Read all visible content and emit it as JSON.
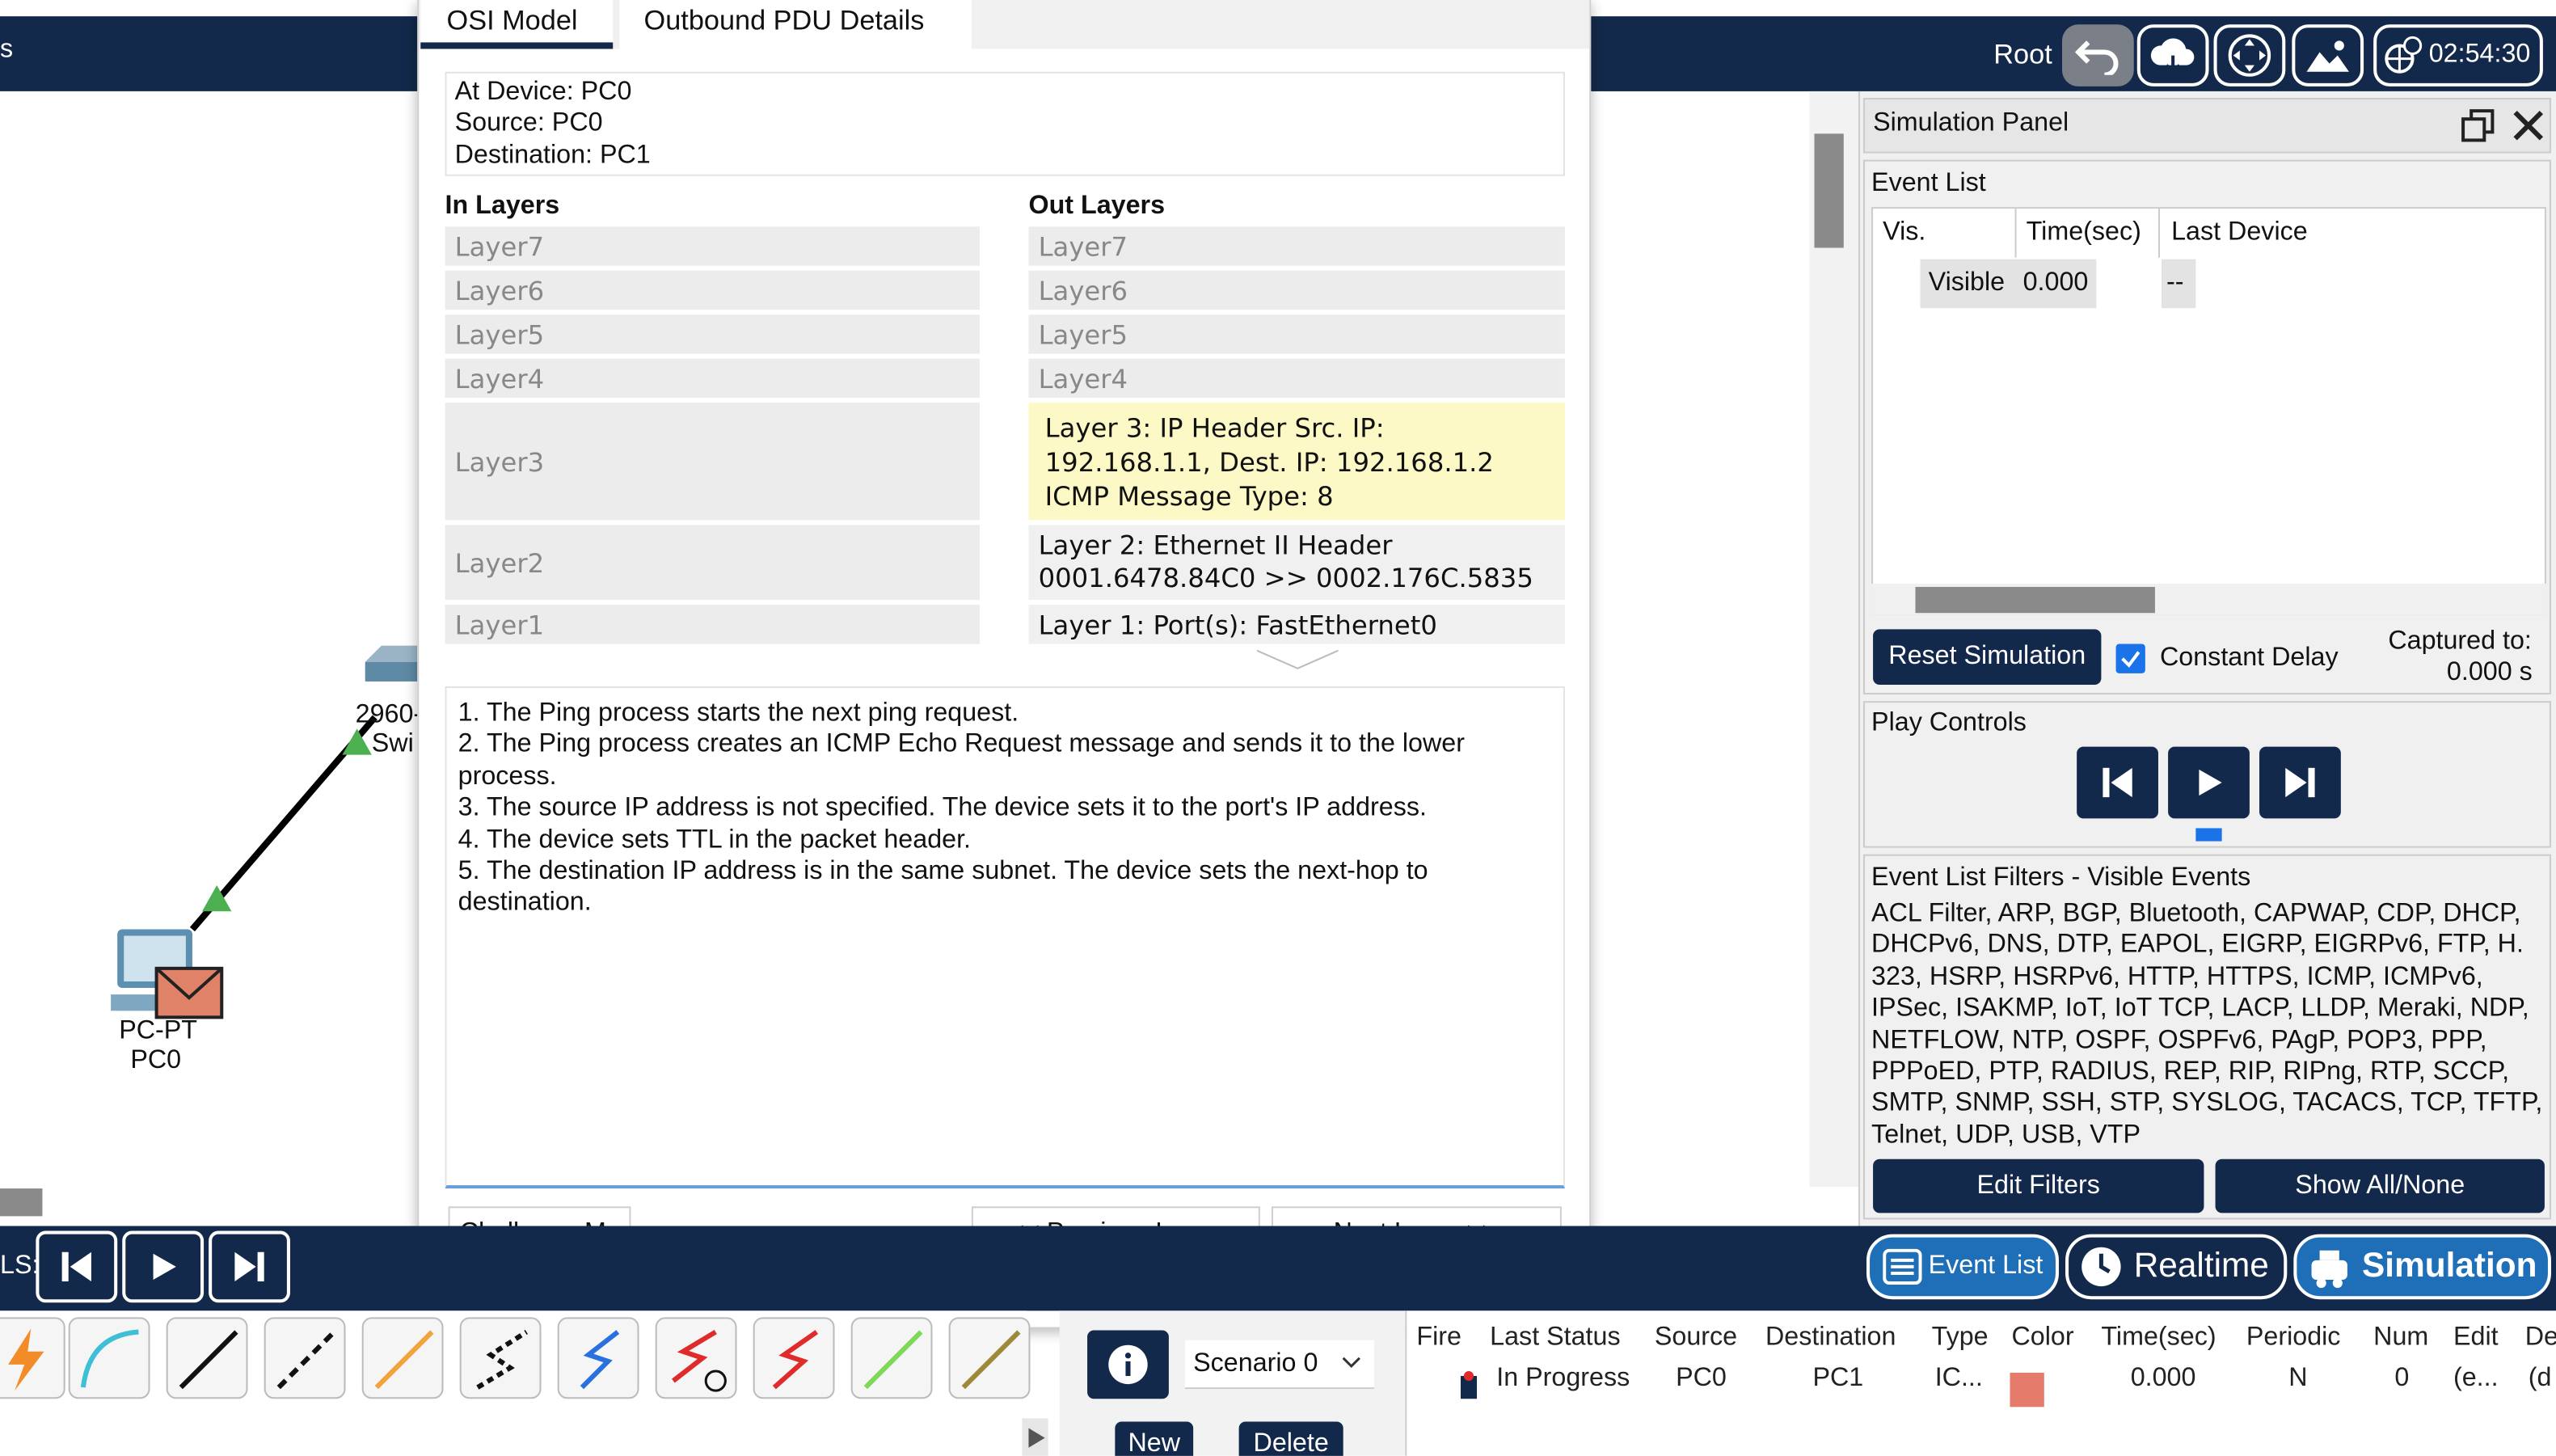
{
  "top_bar": {
    "root_label": "Root",
    "clock": "02:54:30",
    "left_fragment": "s"
  },
  "dialog": {
    "tabs": [
      "OSI Model",
      "Outbound PDU Details"
    ],
    "at_device": "At Device: PC0",
    "source": "Source: PC0",
    "destination": "Destination: PC1",
    "in_layers_title": "In Layers",
    "out_layers_title": "Out Layers",
    "in_layers": [
      "Layer7",
      "Layer6",
      "Layer5",
      "Layer4",
      "Layer3",
      "Layer2",
      "Layer1"
    ],
    "out_layers": [
      "Layer7",
      "Layer6",
      "Layer5",
      "Layer4"
    ],
    "out_layer3": "Layer 3: IP Header Src. IP: 192.168.1.1, Dest. IP: 192.168.1.2 ICMP Message Type: 8",
    "out_layer2_line1": "Layer 2: Ethernet II Header",
    "out_layer2_line2": "0001.6478.84C0 >> 0002.176C.5835",
    "out_layer1": "Layer 1: Port(s): FastEthernet0",
    "description_lines": [
      "1. The Ping process starts the next ping request.",
      "2. The Ping process creates an ICMP Echo Request message and sends it to the lower process.",
      "3. The source IP address is not specified. The device sets it to the port's IP address.",
      "4. The device sets TTL in the packet header.",
      "5. The destination IP address is in the same subnet. The device sets the next-hop to destination."
    ],
    "challenge_button": "Challenge Me",
    "prev_button": "<< Previous Layer",
    "next_button": "Next Layer >>"
  },
  "workspace": {
    "pc_label1": "PC-PT",
    "pc_label2": "PC0",
    "switch_label1": "2960-",
    "switch_label2": "Swi"
  },
  "sim_panel": {
    "title": "Simulation Panel",
    "event_list_title": "Event List",
    "col_vis": "Vis.",
    "col_time": "Time(sec)",
    "col_last_device": "Last Device",
    "row_vis": "Visible",
    "row_time": "0.000",
    "row_last_device": "--",
    "reset_button": "Reset Simulation",
    "constant_delay": "Constant Delay",
    "captured_label": "Captured to:",
    "captured_value": "0.000 s",
    "play_controls_title": "Play Controls",
    "filters_title": "Event List Filters - Visible Events",
    "filters_text": "ACL Filter, ARP, BGP, Bluetooth, CAPWAP, CDP, DHCP, DHCPv6, DNS, DTP, EAPOL, EIGRP, EIGRPv6, FTP, H. 323, HSRP, HSRPv6, HTTP, HTTPS, ICMP, ICMPv6, IPSec, ISAKMP, IoT, IoT TCP, LACP, LLDP, Meraki, NDP, NETFLOW, NTP, OSPF, OSPFv6, PAgP, POP3, PPP, PPPoED, PTP, RADIUS, REP, RIP, RIPng, RTP, SCCP, SMTP, SNMP, SSH, STP, SYSLOG, TACACS, TCP, TFTP, Telnet, UDP, USB, VTP",
    "edit_filters": "Edit Filters",
    "show_all": "Show All/None"
  },
  "mode_bar": {
    "left_fragment": "LS:",
    "event_list_btn": "Event List",
    "realtime_btn": "Realtime",
    "simulation_btn": "Simulation"
  },
  "bottom": {
    "scenario": "Scenario 0",
    "new_btn": "New",
    "delete_btn": "Delete",
    "headers": [
      "Fire",
      "Last Status",
      "Source",
      "Destination",
      "Type",
      "Color",
      "Time(sec)",
      "Periodic",
      "Num",
      "Edit",
      "De"
    ],
    "row": [
      "In Progress",
      "PC0",
      "PC1",
      "IC...",
      "0.000",
      "N",
      "0",
      "(e...",
      "(d"
    ],
    "color_swatch": "#e57c6b"
  },
  "colors": {
    "navy": "#13294b",
    "highlight": "#fcf9c6",
    "accent_blue": "#1a73e8"
  }
}
